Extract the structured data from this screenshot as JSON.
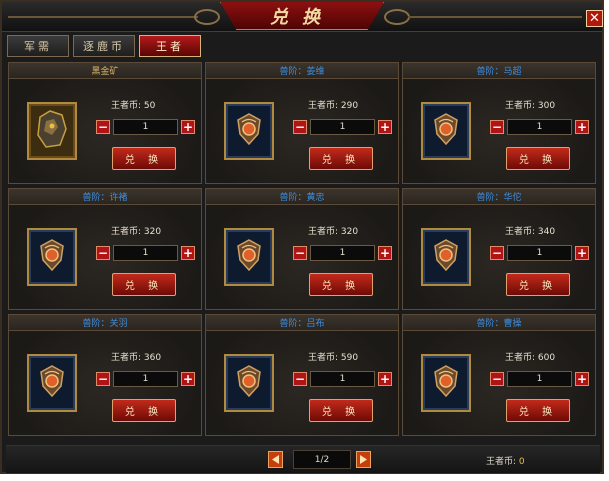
{
  "window": {
    "title": "兑换",
    "close_glyph": "✕"
  },
  "tabs": [
    {
      "label": "军需",
      "active": false
    },
    {
      "label": "逐鹿币",
      "active": false
    },
    {
      "label": "王者",
      "active": true
    }
  ],
  "items": [
    {
      "name": "黑金矿",
      "price_label": "王者币: 50",
      "qty": "1",
      "button": "兑 换",
      "icon": "black-gold-ore-icon"
    },
    {
      "name": "兽阶：姜维",
      "price_label": "王者币: 290",
      "qty": "1",
      "button": "兑 换",
      "icon": "hero-emblem-icon"
    },
    {
      "name": "兽阶：马超",
      "price_label": "王者币: 300",
      "qty": "1",
      "button": "兑 换",
      "icon": "hero-emblem-icon"
    },
    {
      "name": "兽阶：许褚",
      "price_label": "王者币: 320",
      "qty": "1",
      "button": "兑 换",
      "icon": "hero-emblem-icon"
    },
    {
      "name": "兽阶：黄忠",
      "price_label": "王者币: 320",
      "qty": "1",
      "button": "兑 换",
      "icon": "hero-emblem-icon"
    },
    {
      "name": "兽阶：华佗",
      "price_label": "王者币: 340",
      "qty": "1",
      "button": "兑 换",
      "icon": "hero-emblem-icon"
    },
    {
      "name": "兽阶：关羽",
      "price_label": "王者币: 360",
      "qty": "1",
      "button": "兑 换",
      "icon": "hero-emblem-icon"
    },
    {
      "name": "兽阶：吕布",
      "price_label": "王者币: 590",
      "qty": "1",
      "button": "兑 换",
      "icon": "hero-emblem-icon"
    },
    {
      "name": "兽阶：曹操",
      "price_label": "王者币: 600",
      "qty": "1",
      "button": "兑 换",
      "icon": "hero-emblem-icon"
    }
  ],
  "pager": {
    "page": "1/2"
  },
  "footer": {
    "currency_label": "王者币:",
    "currency_value": "0"
  },
  "colors": {
    "accent_red": "#b31a1a",
    "gold": "#d8b46a",
    "name_blue": "#3f8ee0",
    "coin_yellow": "#e8c040"
  }
}
